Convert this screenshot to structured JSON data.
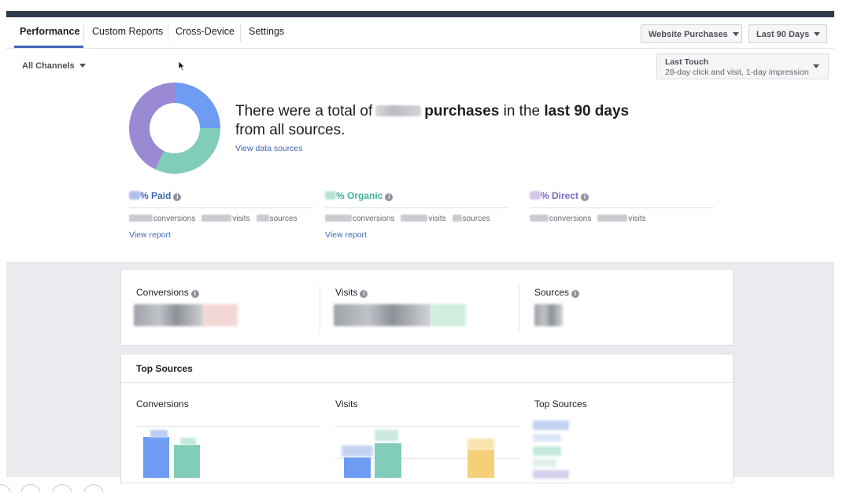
{
  "nav": {
    "tabs": [
      {
        "label": "Performance",
        "active": true
      },
      {
        "label": "Custom Reports"
      },
      {
        "label": "Cross-Device"
      },
      {
        "label": "Settings"
      }
    ],
    "event_dropdown": "Website Purchases",
    "range_dropdown": "Last 90 Days"
  },
  "filters": {
    "channels": "All Channels",
    "attribution_title": "Last Touch",
    "attribution_desc": "28-day click and visit, 1-day impression"
  },
  "summary": {
    "headline_pre": "There were a total of",
    "headline_bold": "purchases",
    "headline_mid": "in the",
    "headline_period": "last 90 days",
    "headline_post": "from all sources.",
    "view_sources": "View data sources",
    "donut": [
      {
        "name": "Paid",
        "fraction": 0.25,
        "color": "#6d9cf2"
      },
      {
        "name": "Organic",
        "fraction": 0.32,
        "color": "#82cdb9"
      },
      {
        "name": "Direct",
        "fraction": 0.43,
        "color": "#9a89d3"
      }
    ]
  },
  "channels": [
    {
      "label": "% Paid",
      "color": "#4267b2",
      "s1": "conversions",
      "s2": "visits",
      "s3": "sources",
      "link": "View report"
    },
    {
      "label": "% Organic",
      "color": "#3fb393",
      "s1": "conversions",
      "s2": "visits",
      "s3": "sources",
      "link": "View report"
    },
    {
      "label": "% Direct",
      "color": "#7b68c4",
      "s1": "conversions",
      "s2": "visits"
    }
  ],
  "metrics": {
    "conversions": "Conversions",
    "visits": "Visits",
    "sources": "Sources"
  },
  "top_sources": {
    "title": "Top Sources",
    "col_conversions": "Conversions",
    "col_visits": "Visits",
    "col_top": "Top Sources"
  },
  "colors": {
    "paid": "#6d9cf2",
    "organic": "#82cdb9",
    "direct": "#9a89d3",
    "accent": "#4267b2",
    "yellow": "#f5d078"
  }
}
